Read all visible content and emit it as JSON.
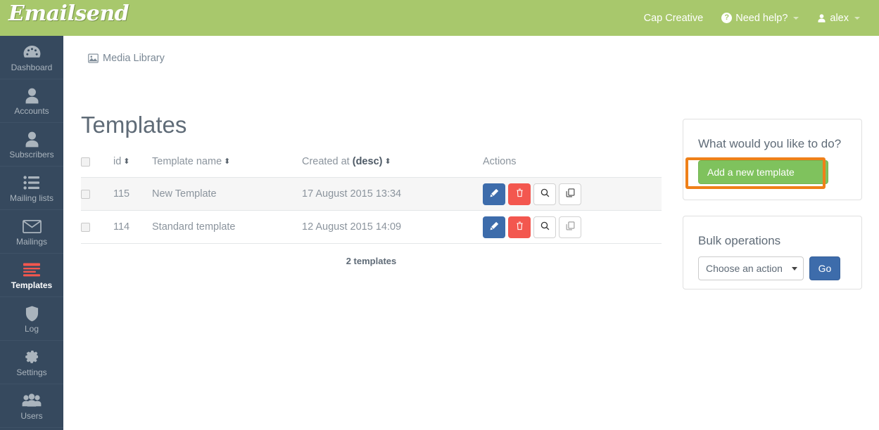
{
  "header": {
    "brand": "Emailsend",
    "nav": [
      {
        "label": "Cap Creative",
        "icon": "",
        "caret": false
      },
      {
        "label": "Need help?",
        "icon": "question-circle-icon",
        "caret": true
      },
      {
        "label": "alex",
        "icon": "user-icon",
        "caret": true
      }
    ],
    "brand_bg": "#a8c86c"
  },
  "sidebar": {
    "bg": "#36495e",
    "active_color": "#f3574f",
    "items": [
      {
        "label": "Dashboard",
        "icon": "dashboard-icon",
        "active": false
      },
      {
        "label": "Accounts",
        "icon": "user-icon",
        "active": false
      },
      {
        "label": "Subscribers",
        "icon": "user-icon",
        "active": false
      },
      {
        "label": "Mailing lists",
        "icon": "list-icon",
        "active": false
      },
      {
        "label": "Mailings",
        "icon": "envelope-icon",
        "active": false
      },
      {
        "label": "Templates",
        "icon": "templates-icon",
        "active": true
      },
      {
        "label": "Log",
        "icon": "shield-icon",
        "active": false
      },
      {
        "label": "Settings",
        "icon": "gear-icon",
        "active": false
      },
      {
        "label": "Users",
        "icon": "users-icon",
        "active": false
      }
    ]
  },
  "main": {
    "media_library_link": "Media Library",
    "media_library_icon": "image-icon",
    "page_title": "Templates",
    "table": {
      "columns": [
        {
          "key": "check",
          "label": "",
          "sortable": false
        },
        {
          "key": "id",
          "label": "id",
          "sortable": true,
          "active": false
        },
        {
          "key": "name",
          "label": "Template name",
          "sortable": true,
          "active": false
        },
        {
          "key": "created",
          "label": "Created at",
          "sort_suffix": "(desc)",
          "sortable": true,
          "active": true
        },
        {
          "key": "actions",
          "label": "Actions",
          "sortable": false
        }
      ],
      "rows": [
        {
          "checked": false,
          "id": "115",
          "name": "New Template",
          "created": "17 August 2015 13:34",
          "actions": [
            "edit-icon",
            "trash-icon",
            "search-icon",
            "duplicate-icon"
          ]
        },
        {
          "checked": false,
          "id": "114",
          "name": "Standard template",
          "created": "12 August 2015 14:09",
          "actions": [
            "edit-icon",
            "trash-icon",
            "search-icon",
            "duplicate-icon"
          ]
        }
      ],
      "footer": "2 templates"
    }
  },
  "panels": {
    "actions": {
      "title": "What would you like to do?",
      "add_button": "Add a new template",
      "add_button_color": "#7fc25d",
      "highlight_color": "#ef8019"
    },
    "bulk": {
      "title": "Bulk operations",
      "select_value": "Choose an action",
      "go_button": "Go",
      "go_button_color": "#3d6cab"
    }
  }
}
